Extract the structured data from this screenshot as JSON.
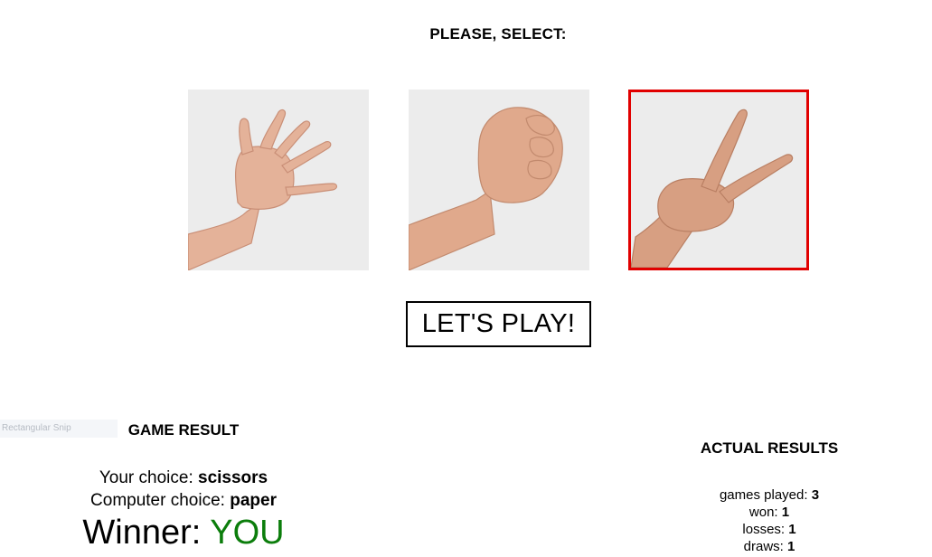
{
  "heading": "PLEASE, SELECT:",
  "choices": [
    {
      "id": "paper",
      "selected": false
    },
    {
      "id": "rock",
      "selected": false
    },
    {
      "id": "scissors",
      "selected": true
    }
  ],
  "play_button": "LET'S PLAY!",
  "overlay_text": "Rectangular Snip",
  "game_result": {
    "title": "GAME RESULT",
    "your_choice_label": "Your choice: ",
    "your_choice": "scissors",
    "computer_choice_label": "Computer choice: ",
    "computer_choice": "paper",
    "winner_label": "Winner: ",
    "winner": "YOU"
  },
  "actual_results": {
    "title": "ACTUAL RESULTS",
    "games_played_label": "games played: ",
    "games_played": "3",
    "won_label": "won: ",
    "won": "1",
    "losses_label": "losses: ",
    "losses": "1",
    "draws_label": "draws: ",
    "draws": "1"
  },
  "colors": {
    "selected_border": "#e10000",
    "winner": "#0b7d0b"
  }
}
